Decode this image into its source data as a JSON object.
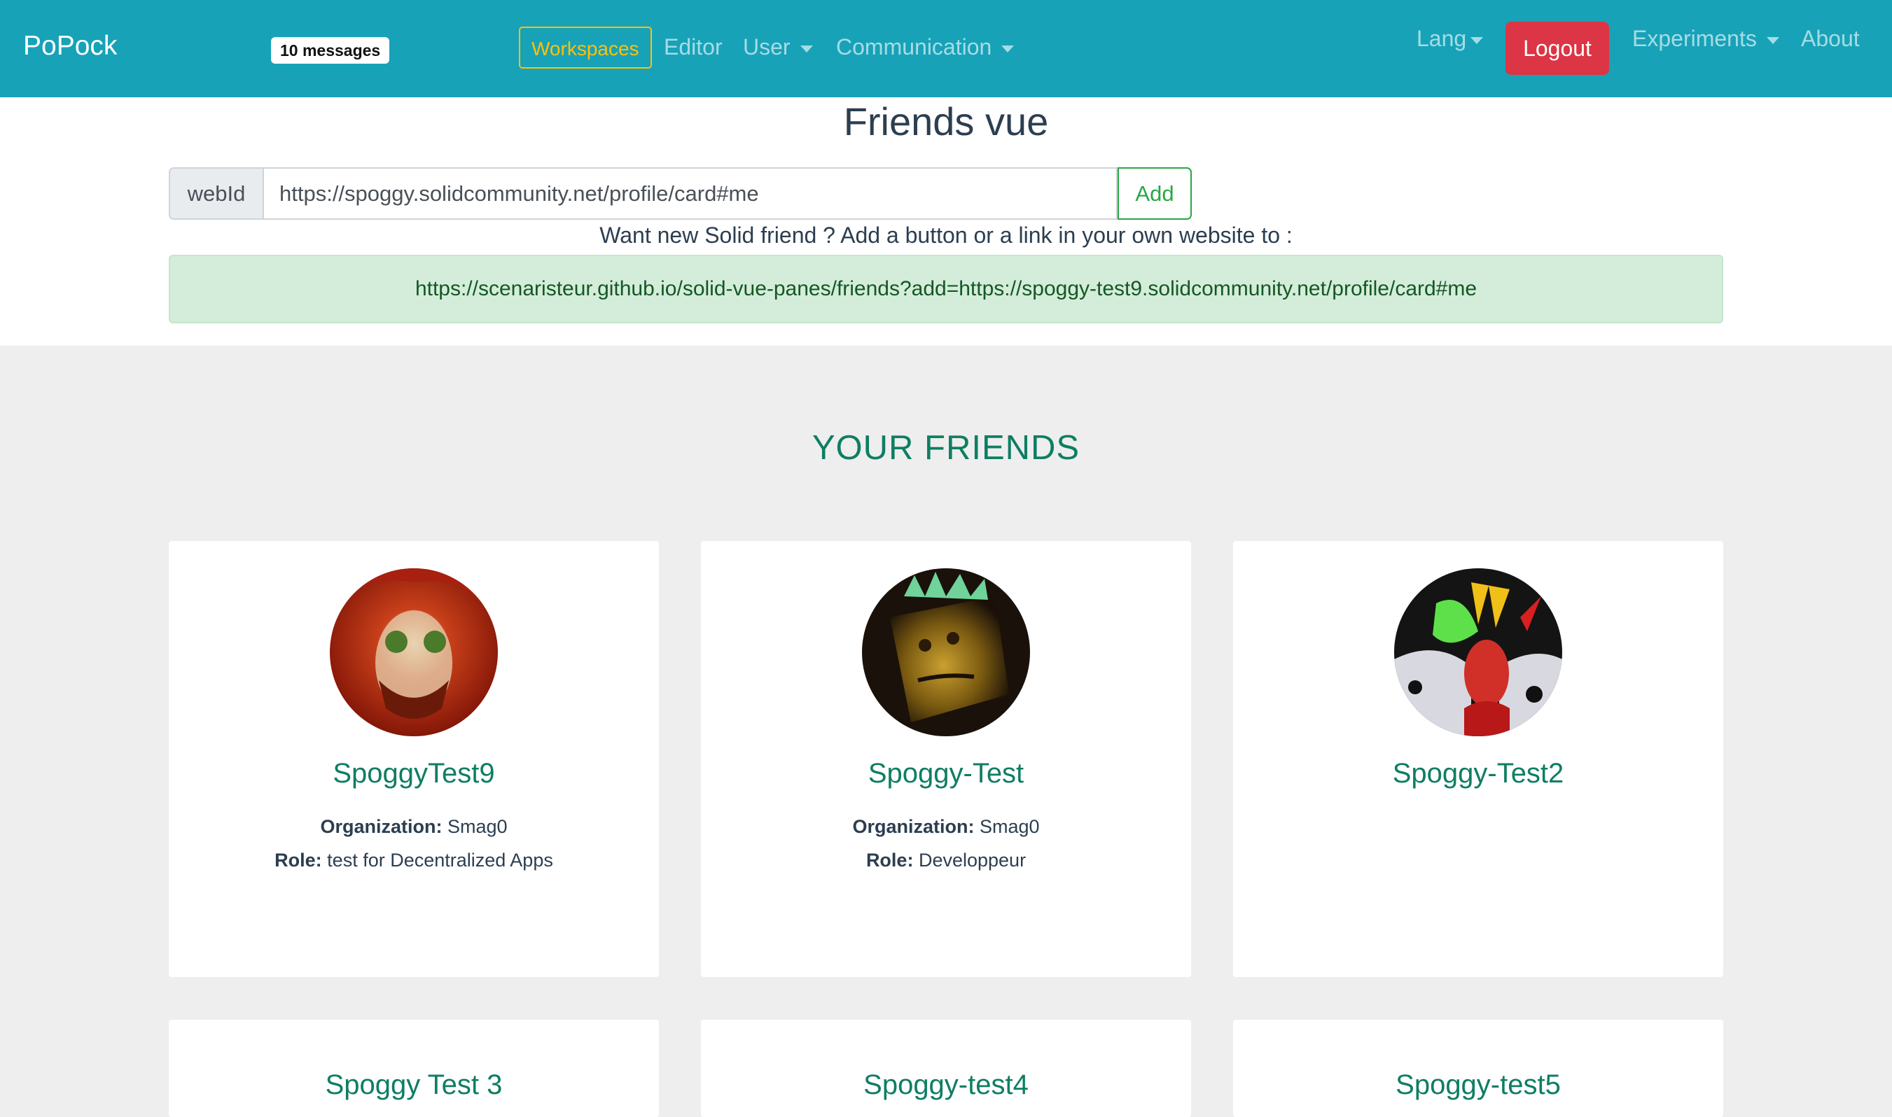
{
  "navbar": {
    "brand": "PoPock",
    "messages_badge": "10 messages",
    "items": {
      "workspaces": "Workspaces",
      "editor": "Editor",
      "user": "User",
      "communication": "Communication",
      "lang": "Lang",
      "logout": "Logout",
      "experiments": "Experiments",
      "about": "About"
    }
  },
  "page": {
    "title": "Friends vue",
    "webid_label": "webId",
    "webid_value": "https://spoggy.solidcommunity.net/profile/card#me",
    "add_button": "Add",
    "hint": "Want new Solid friend ? Add a button or a link in your own website to :",
    "share_link": "https://scenaristeur.github.io/solid-vue-panes/friends?add=https://spoggy-test9.solidcommunity.net/profile/card#me"
  },
  "friends": {
    "heading": "YOUR FRIENDS",
    "org_label": "Organization:",
    "role_label": "Role:",
    "cards": [
      {
        "name": "SpoggyTest9",
        "organization": "Smag0",
        "role": "test for Decentralized Apps"
      },
      {
        "name": "Spoggy-Test",
        "organization": "Smag0",
        "role": "Developpeur"
      },
      {
        "name": "Spoggy-Test2"
      },
      {
        "name": "Spoggy Test 3"
      },
      {
        "name": "Spoggy-test4"
      },
      {
        "name": "Spoggy-test5"
      }
    ]
  },
  "colors": {
    "navbar": "#17a2b8",
    "logout": "#dc3545",
    "workspaces_outline": "#ffc107",
    "friend_name": "#0e7e63",
    "alert_bg": "#d4edda"
  }
}
